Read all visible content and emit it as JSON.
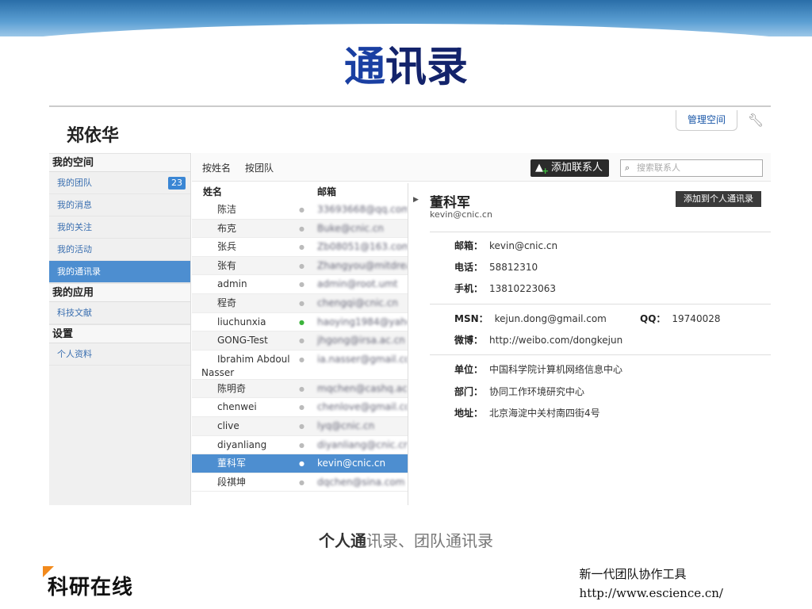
{
  "slide": {
    "title_highlight": "通",
    "title_rest": "讯录",
    "caption_strong": "个人通",
    "caption_rest": "讯录、团队通讯录",
    "footer_line1": "新一代团队协作工具",
    "footer_line2": "http://www.escience.cn/",
    "logo_text": "科研在线"
  },
  "app": {
    "user_name": "郑依华",
    "manage_space_label": "管理空间",
    "wrench_icon": "wrench-icon"
  },
  "sidebar": {
    "sections": [
      {
        "title": "我的空间"
      },
      {
        "title": "我的应用"
      },
      {
        "title": "设置"
      }
    ],
    "items": [
      {
        "label": "我的团队",
        "badge": "23"
      },
      {
        "label": "我的消息"
      },
      {
        "label": "我的关注"
      },
      {
        "label": "我的活动"
      },
      {
        "label": "我的通讯录",
        "active": true
      },
      {
        "label": "科技文献"
      },
      {
        "label": "个人资料"
      }
    ]
  },
  "toolbar": {
    "tab_by_name": "按姓名",
    "tab_by_team": "按团队",
    "add_contact_label": "添加联系人",
    "search_placeholder": "搜索联系人"
  },
  "list": {
    "col_name": "姓名",
    "col_email": "邮箱",
    "rows": [
      {
        "name": "陈洁",
        "email": "33693668@qq.com"
      },
      {
        "name": "布克",
        "email": "Buke@cnic.cn"
      },
      {
        "name": "张兵",
        "email": "Zb08051@163.com"
      },
      {
        "name": "张有",
        "email": "Zhangyou@mitdream."
      },
      {
        "name": "admin",
        "email": "admin@root.umt"
      },
      {
        "name": "程奇",
        "email": "chengqi@cnic.cn"
      },
      {
        "name": "liuchunxia",
        "email": "haoying1984@yahoo."
      },
      {
        "name": "GONG-Test",
        "email": "jhgong@irsa.ac.cn"
      },
      {
        "name": "Ibrahim Abdoul Nasser",
        "email": "ia.nasser@gmail.com"
      },
      {
        "name": "陈明奇",
        "email": "mqchen@cashq.ac.c"
      },
      {
        "name": "chenwei",
        "email": "chenlove@gmail.com"
      },
      {
        "name": "clive",
        "email": "lyq@cnic.cn"
      },
      {
        "name": "diyanliang",
        "email": "diyanliang@cnic.cn"
      },
      {
        "name": "董科军",
        "email": "kevin@cnic.cn"
      },
      {
        "name": "段祺坤",
        "email": "dqchen@sina.com"
      }
    ]
  },
  "detail": {
    "name": "董科军",
    "email_sub": "kevin@cnic.cn",
    "add_personal_label": "添加到个人通讯录",
    "email_label": "邮箱：",
    "email": "kevin@cnic.cn",
    "phone_label": "电话：",
    "phone": "58812310",
    "mobile_label": "手机：",
    "mobile": "13810223063",
    "msn_label": "MSN：",
    "msn": "kejun.dong@gmail.com",
    "qq_label": "QQ：",
    "qq": "19740028",
    "weibo_label": "微博：",
    "weibo": "http://weibo.com/dongkejun",
    "org_label": "单位：",
    "org": "中国科学院计算机网络信息中心",
    "dept_label": "部门：",
    "dept": "协同工作环境研究中心",
    "addr_label": "地址：",
    "addr": "北京海淀中关村南四街4号"
  }
}
